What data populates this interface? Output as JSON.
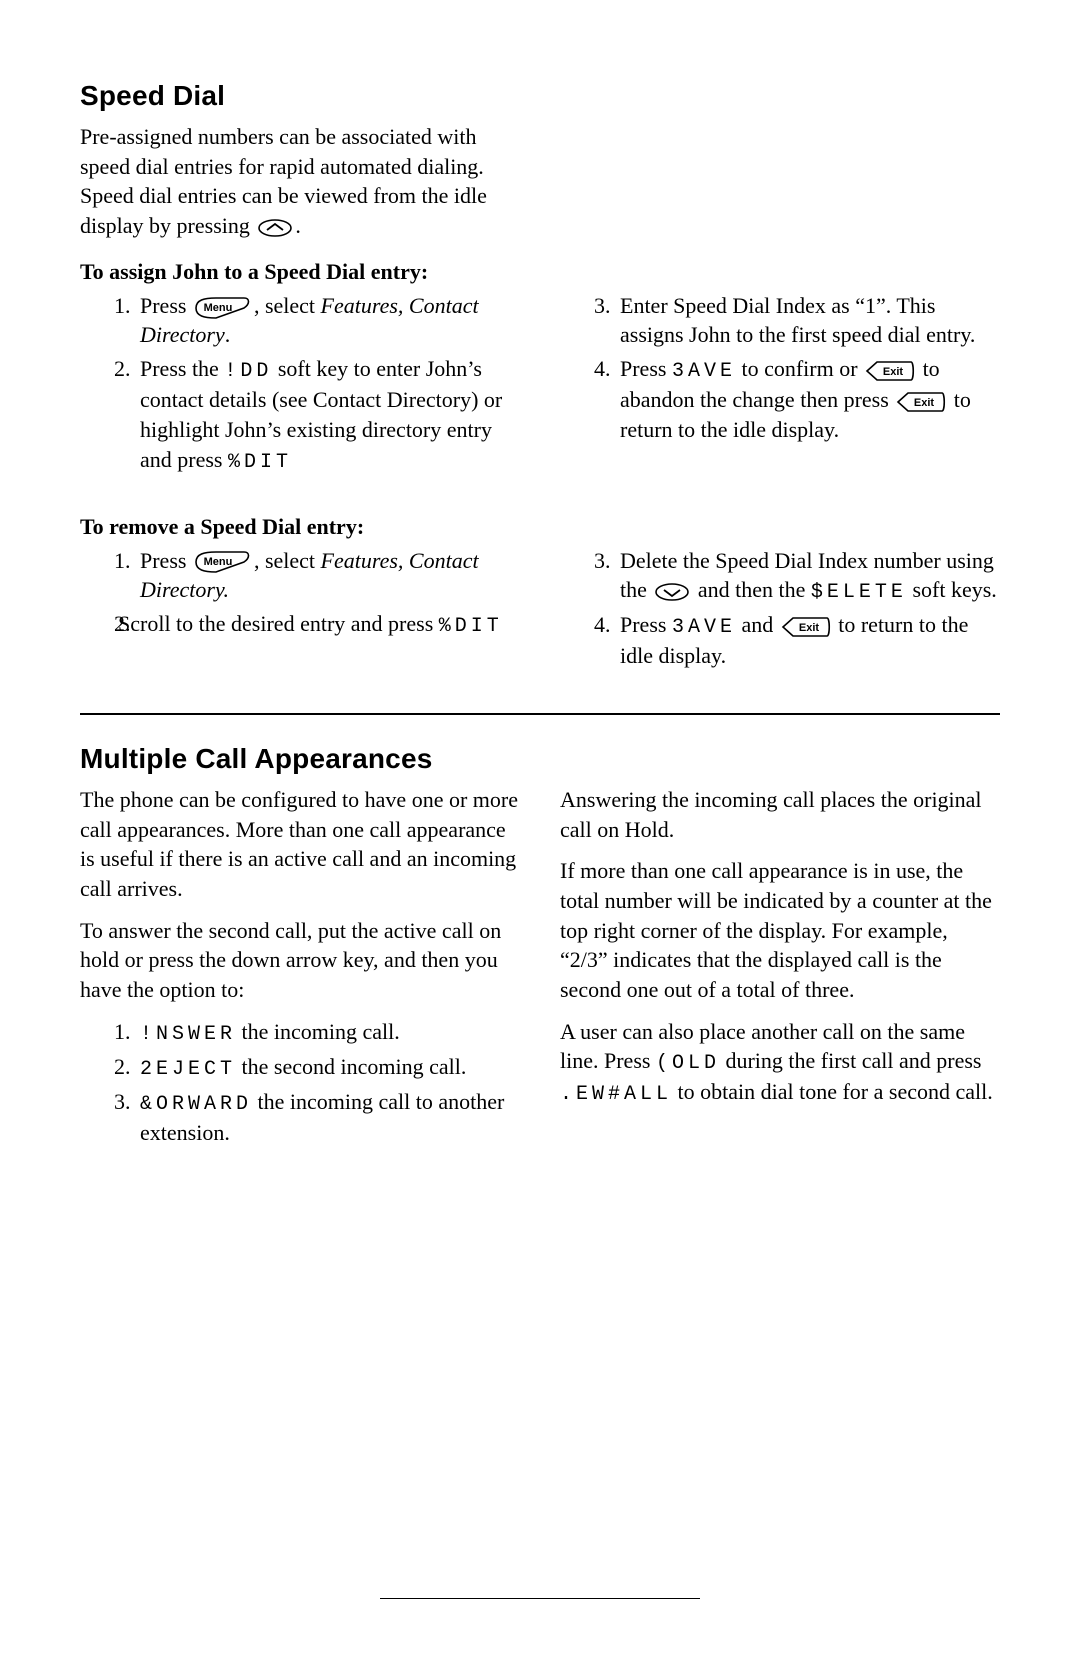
{
  "sec1": {
    "heading": "Speed Dial",
    "intro": "Pre-assigned numbers can be associated with speed dial entries for rapid automated dialing.  Speed dial entries can be viewed from the idle display by pressing ",
    "intro_after": ".",
    "assign_head": "To assign John to a Speed Dial entry:",
    "assign": {
      "l1a": "Press ",
      "l1b": ", select ",
      "l1c": "Features, Contact Directory",
      "l1d": ".",
      "l2a": "Press the ",
      "l2key": "!DD",
      "l2b": " soft key to enter John’s contact details (see Contact Directory) or highlight John’s existing directory entry and press ",
      "l2key2": "%DIT",
      "r3a": "Enter Speed Dial Index as “1”. This assigns John to the first speed dial entry.",
      "r4a": "Press ",
      "r4key": "3AVE",
      "r4b": " to confirm or ",
      "r4c": " to abandon the change then press ",
      "r4d": " to return to the idle display."
    },
    "remove_head": "To remove a Speed Dial entry:",
    "remove": {
      "l1a": "Press ",
      "l1b": ", select ",
      "l1c": "Features, Contact Directory.",
      "l2a": "Scroll to the desired entry and press ",
      "l2key": "%DIT",
      "r3a": "Delete the Speed Dial Index number using the ",
      "r3b": " and then the ",
      "r3key": "$ELETE",
      "r3c": " soft keys.",
      "r4a": "Press ",
      "r4key": "3AVE",
      "r4b": " and ",
      "r4c": " to return to the idle display."
    }
  },
  "sec2": {
    "heading": "Multiple Call Appearances",
    "p1": "The phone can be configured to have one or more call appearances.  More than one call appearance is useful if there is an active call and an incoming call arrives.",
    "p2": "To answer the second call, put the active call on hold or press the down arrow key, and then you have the option to:",
    "list": {
      "i1a": "!NSWER",
      "i1b": " the incoming call.",
      "i2a": "2EJECT",
      "i2b": " the second incoming call.",
      "i3a": "&ORWARD",
      "i3b": " the incoming call to another extension."
    },
    "p3": "Answering the incoming call places the original call on Hold.",
    "p4": "If more than one call appearance is in use, the total number will be indicated by a counter at the top right corner of the display.  For example, “2/3” indicates that the displayed call is the second one out of a total of three.",
    "p5a": "A user can also place another call on the same line.  Press ",
    "p5key1": "(OLD",
    "p5b": " during the first call and press ",
    "p5key2": ".EW#ALL",
    "p5c": " to obtain dial tone for a second call."
  },
  "labels": {
    "menu": "Menu",
    "exit": "Exit"
  }
}
